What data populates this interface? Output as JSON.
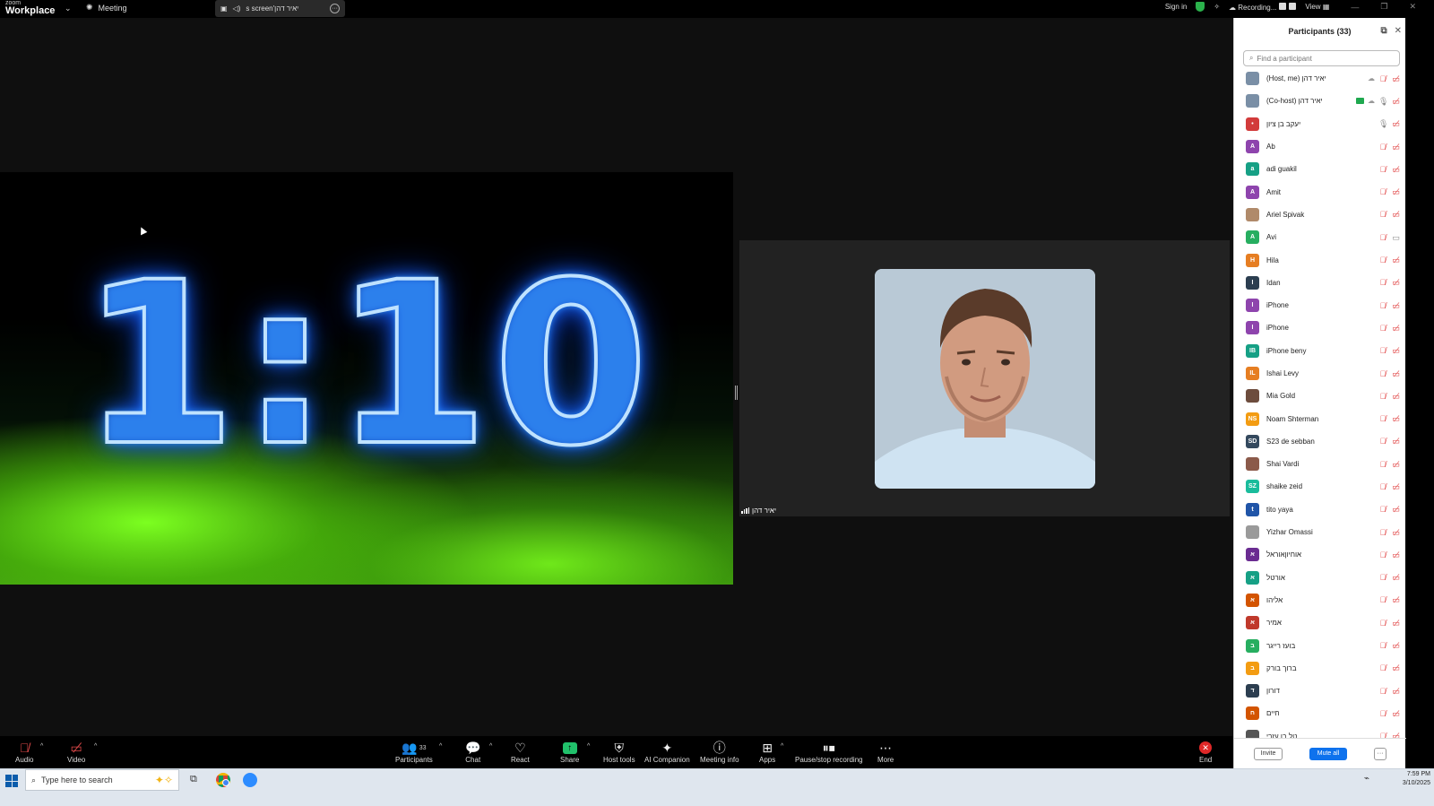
{
  "titlebar": {
    "brand_small": "zoom",
    "brand_big": "Workplace",
    "meeting_label": "Meeting",
    "screen_label": "יאיר דהן's screen",
    "sign_in": "Sign in",
    "recording": "Recording...",
    "view": "View"
  },
  "shared": {
    "countdown": "1:10"
  },
  "video": {
    "name": "יאיר דהן"
  },
  "toolbar": {
    "audio": "Audio",
    "video": "Video",
    "participants": "Participants",
    "participants_count": "33",
    "chat": "Chat",
    "react": "React",
    "share": "Share",
    "host_tools": "Host tools",
    "ai_companion": "AI Companion",
    "meeting_info": "Meeting info",
    "apps": "Apps",
    "pause_stop": "Pause/stop recording",
    "more": "More",
    "end": "End"
  },
  "panel": {
    "title": "Participants (33)",
    "search_placeholder": "Find a participant",
    "invite": "Invite",
    "mute_all": "Mute all",
    "participants": [
      {
        "name": "יאיר דהן (Host, me)",
        "initials": "",
        "color": "#7a8fa6",
        "photo": true
      },
      {
        "name": "יאיר דהן (Co-host)",
        "initials": "",
        "color": "#7a8fa6",
        "photo": true
      },
      {
        "name": "יעקב בן ציון",
        "initials": "•",
        "color": "#d23b3b",
        "photo": false
      },
      {
        "name": "Ab",
        "initials": "A",
        "color": "#8e44ad",
        "photo": false
      },
      {
        "name": "adi guakil",
        "initials": "a",
        "color": "#16a085",
        "photo": false
      },
      {
        "name": "Amit",
        "initials": "A",
        "color": "#8e44ad",
        "photo": false
      },
      {
        "name": "Ariel Spivak",
        "initials": "",
        "color": "#b08a6a",
        "photo": true
      },
      {
        "name": "Avi",
        "initials": "A",
        "color": "#27ae60",
        "photo": false
      },
      {
        "name": "Hila",
        "initials": "H",
        "color": "#e67e22",
        "photo": false
      },
      {
        "name": "Idan",
        "initials": "I",
        "color": "#2c3e50",
        "photo": false
      },
      {
        "name": "iPhone",
        "initials": "I",
        "color": "#8e44ad",
        "photo": false
      },
      {
        "name": "iPhone",
        "initials": "I",
        "color": "#8e44ad",
        "photo": false
      },
      {
        "name": "iPhone beny",
        "initials": "IB",
        "color": "#16a085",
        "photo": false
      },
      {
        "name": "Ishai Levy",
        "initials": "IL",
        "color": "#e67e22",
        "photo": false
      },
      {
        "name": "Mia Gold",
        "initials": "",
        "color": "#6d4c3d",
        "photo": true
      },
      {
        "name": "Noam Shterman",
        "initials": "NS",
        "color": "#f39c12",
        "photo": false
      },
      {
        "name": "S23 de sebban",
        "initials": "SD",
        "color": "#34495e",
        "photo": false
      },
      {
        "name": "Shai Vardi",
        "initials": "",
        "color": "#8b5a4a",
        "photo": true
      },
      {
        "name": "shaike zeid",
        "initials": "SZ",
        "color": "#1abc9c",
        "photo": false
      },
      {
        "name": "tito yaya",
        "initials": "t",
        "color": "#2055a8",
        "photo": false
      },
      {
        "name": "Yizhar Omassi",
        "initials": "",
        "color": "#9a9a9a",
        "photo": true
      },
      {
        "name": "אוחיוןאוראל",
        "initials": "א",
        "color": "#6a2c91",
        "photo": false
      },
      {
        "name": "אורטל",
        "initials": "א",
        "color": "#16a085",
        "photo": false
      },
      {
        "name": "אליהו",
        "initials": "א",
        "color": "#d35400",
        "photo": false
      },
      {
        "name": "אמיר",
        "initials": "א",
        "color": "#c0392b",
        "photo": false
      },
      {
        "name": "בועז רייגר",
        "initials": "ב",
        "color": "#27ae60",
        "photo": false
      },
      {
        "name": "ברוך בורק",
        "initials": "ב",
        "color": "#f39c12",
        "photo": false
      },
      {
        "name": "דורון",
        "initials": "ד",
        "color": "#2c3e50",
        "photo": false
      },
      {
        "name": "חיים",
        "initials": "ח",
        "color": "#d35400",
        "photo": false
      },
      {
        "name": "טל בן עזרי",
        "initials": "",
        "color": "#555",
        "photo": true
      }
    ]
  },
  "taskbar": {
    "search_placeholder": "Type here to search",
    "time": "7:59 PM",
    "date": "3/10/2025"
  }
}
